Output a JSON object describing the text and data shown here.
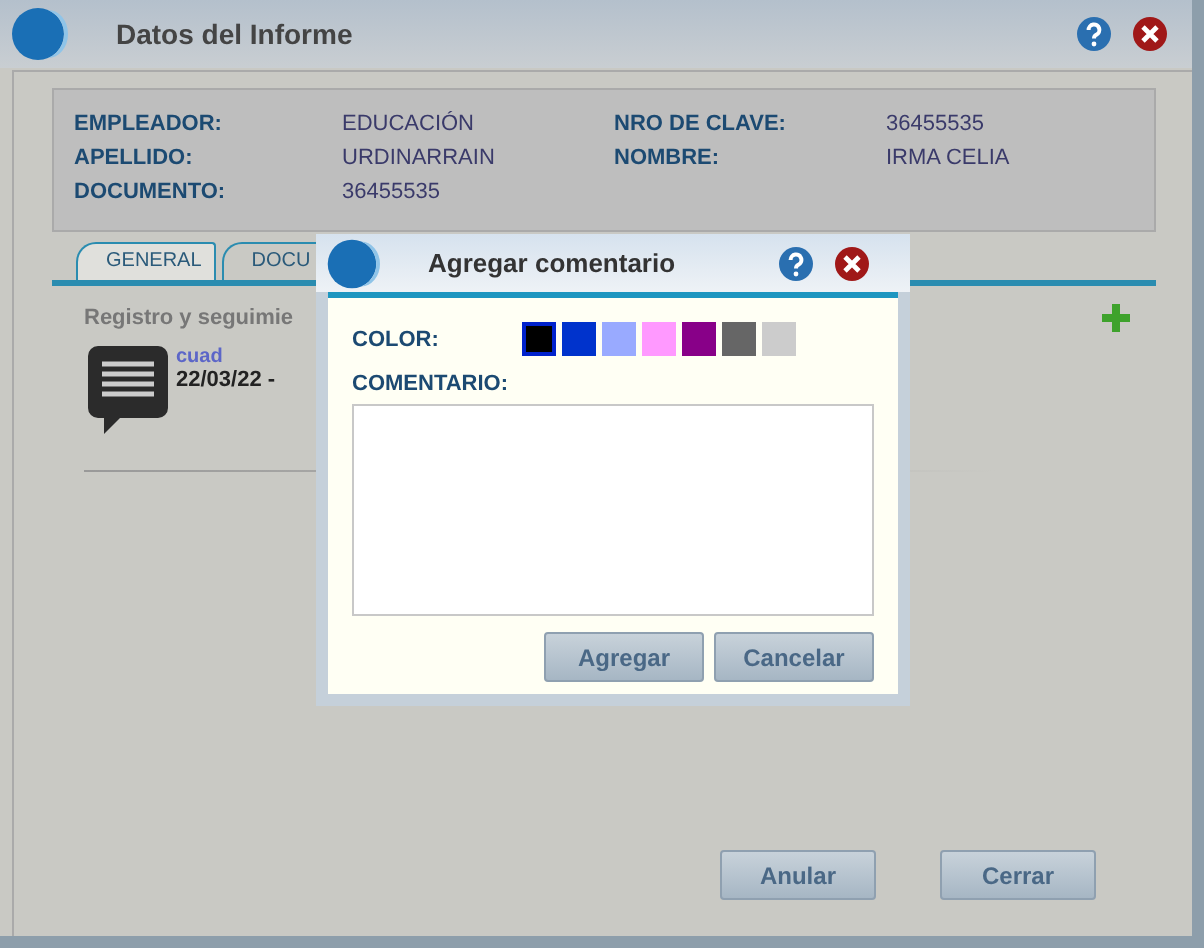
{
  "window": {
    "title": "Datos del Informe"
  },
  "info": [
    {
      "label": "EMPLEADOR:",
      "value": "EDUCACIÓN"
    },
    {
      "label": "NRO DE CLAVE:",
      "value": "36455535"
    },
    {
      "label": "APELLIDO:",
      "value": "URDINARRAIN"
    },
    {
      "label": "NOMBRE:",
      "value": "IRMA CELIA"
    },
    {
      "label": "DOCUMENTO:",
      "value": "36455535"
    }
  ],
  "tabs": [
    {
      "label": "GENERAL",
      "selected": true
    },
    {
      "label": "DOCU",
      "selected": false
    }
  ],
  "section_title": "Registro y seguimie",
  "comments": [
    {
      "author": "cuad",
      "date": "22/03/22 -"
    }
  ],
  "buttons": [
    "Anular",
    "Cerrar"
  ],
  "dialog": {
    "title": "Agregar comentario",
    "color_label": "COLOR:",
    "comment_label": "COMENTARIO:",
    "colors": [
      {
        "color": "#000000",
        "selected": true
      },
      {
        "color": "#0033cc",
        "selected": false
      },
      {
        "color": "#99aaff",
        "selected": false
      },
      {
        "color": "#ff99ff",
        "selected": false
      },
      {
        "color": "#880088",
        "selected": false
      },
      {
        "color": "#666666",
        "selected": false
      },
      {
        "color": "#cccccc",
        "selected": false
      }
    ],
    "buttons": [
      "Agregar",
      "Cancelar"
    ]
  }
}
